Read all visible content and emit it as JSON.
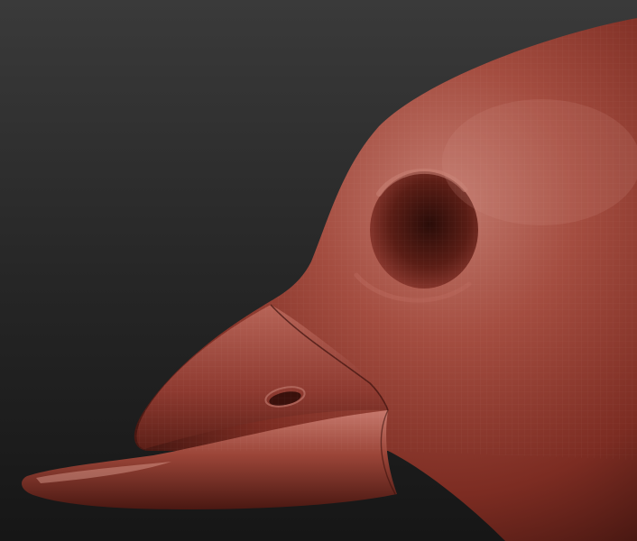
{
  "viewport": {
    "background_top": "#3a3a3a",
    "background_bottom": "#161616",
    "subject": "sculpted-bird-head",
    "material_colors": {
      "base": "#8e3a30",
      "highlight": "#c27a6e",
      "shadow": "#4a1812",
      "deep_shadow": "#2a0c08"
    },
    "wireframe_visible": true
  }
}
